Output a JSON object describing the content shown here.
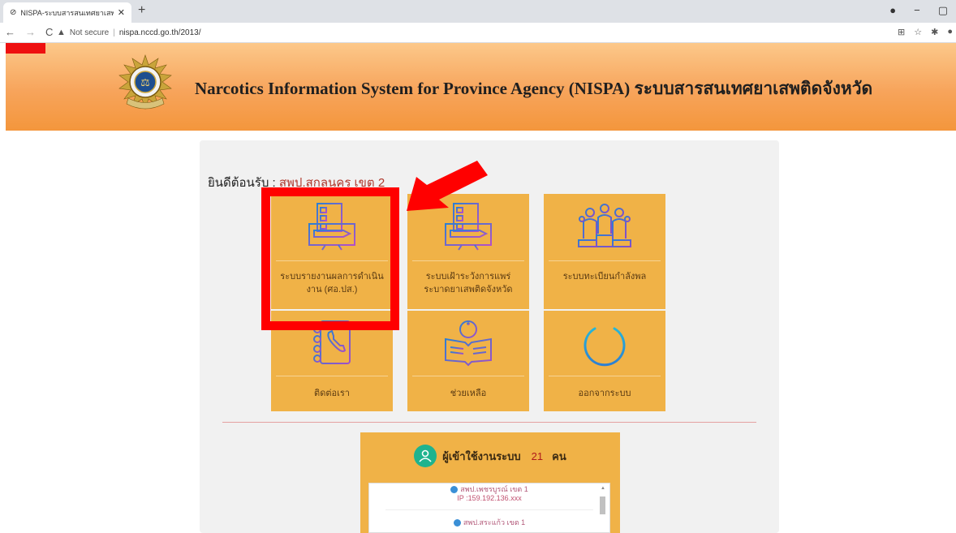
{
  "browser": {
    "tab_title": "NISPA-ระบบสารสนเทศยาเสพติดจังหวัด",
    "tab_close": "✕",
    "new_tab": "+",
    "back": "←",
    "forward": "→",
    "reload": "C",
    "security_label": "Not secure",
    "url": "nispa.nccd.go.th/2013/"
  },
  "header": {
    "title": "Narcotics Information System for Province Agency (NISPA) ระบบสารสนเทศยาเสพติดจังหวัด"
  },
  "welcome": {
    "prefix": "ยินดีต้อนรับ : ",
    "agency": "สพป.สกลนคร เขต 2"
  },
  "tiles": [
    {
      "label_line1": "ระบบรายงานผลการดำเนิน",
      "label_line2": "งาน (ศอ.ปส.)",
      "icon": "report-monitor-icon"
    },
    {
      "label_line1": "ระบบเฝ้าระวังการแพร่",
      "label_line2": "ระบาดยาเสพติดจังหวัด",
      "icon": "surveillance-monitor-icon"
    },
    {
      "label_line1": "ระบบทะเบียนกำลังพล",
      "label_line2": "",
      "icon": "people-registry-icon"
    },
    {
      "label_line1": "ติดต่อเรา",
      "label_line2": "",
      "icon": "phone-book-icon"
    },
    {
      "label_line1": "ช่วยเหลือ",
      "label_line2": "",
      "icon": "help-book-icon"
    },
    {
      "label_line1": "ออกจากระบบ",
      "label_line2": "",
      "icon": "power-icon"
    }
  ],
  "users_online": {
    "label": "ผู้เข้าใช้งานระบบ",
    "count": "21",
    "unit": "คน",
    "entries": [
      {
        "name": "สพป.เพชรบูรณ์ เขต 1",
        "ip": "IP :159.192.136.xxx"
      },
      {
        "name": "สพป.สระแก้ว เขต 1",
        "ip": ""
      }
    ]
  },
  "colors": {
    "tile": "#f0b247",
    "highlight": "#ff0000",
    "agency_text": "#b03a2e"
  }
}
